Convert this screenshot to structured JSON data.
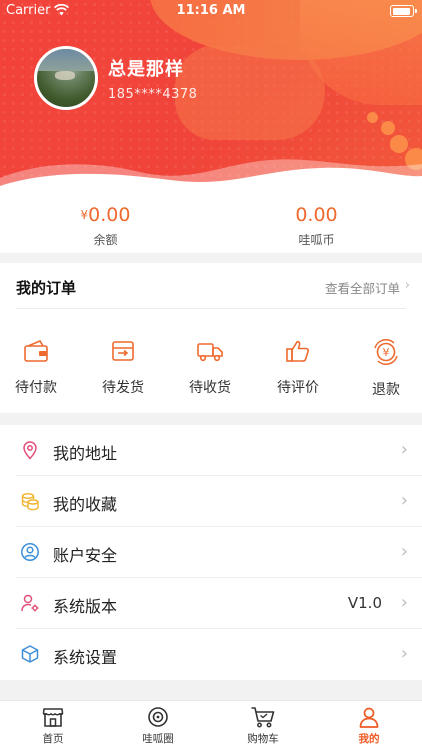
{
  "status_bar": {
    "carrier": "Carrier",
    "time": "11:16 AM"
  },
  "profile": {
    "nickname": "总是那样",
    "phone": "185****4378"
  },
  "wallet": {
    "balance": {
      "currency": "¥",
      "value": "0.00",
      "label": "余额"
    },
    "coins": {
      "value": "0.00",
      "label": "哇呱币"
    }
  },
  "orders": {
    "title": "我的订单",
    "view_all": "查看全部订单",
    "items": [
      {
        "label": "待付款",
        "icon": "wallet-icon"
      },
      {
        "label": "待发货",
        "icon": "box-icon"
      },
      {
        "label": "待收货",
        "icon": "truck-icon"
      },
      {
        "label": "待评价",
        "icon": "thumbs-up-icon"
      },
      {
        "label": "退款",
        "icon": "refund-icon"
      }
    ]
  },
  "menu": [
    {
      "label": "我的地址",
      "icon": "location-pin-icon",
      "value": ""
    },
    {
      "label": "我的收藏",
      "icon": "coins-stack-icon",
      "value": ""
    },
    {
      "label": "账户安全",
      "icon": "user-circle-icon",
      "value": ""
    },
    {
      "label": "系统版本",
      "icon": "user-gear-icon",
      "value": "V1.0"
    },
    {
      "label": "系统设置",
      "icon": "cube-icon",
      "value": ""
    }
  ],
  "tabbar": {
    "active": 3,
    "items": [
      {
        "label": "首页",
        "icon": "shop-icon"
      },
      {
        "label": "哇呱圈",
        "icon": "circle-target-icon"
      },
      {
        "label": "购物车",
        "icon": "cart-icon"
      },
      {
        "label": "我的",
        "icon": "person-icon"
      }
    ]
  },
  "colors": {
    "primary": "#f0443a",
    "accent": "#ee5a24",
    "icon_orange": "#ee6a2f"
  }
}
